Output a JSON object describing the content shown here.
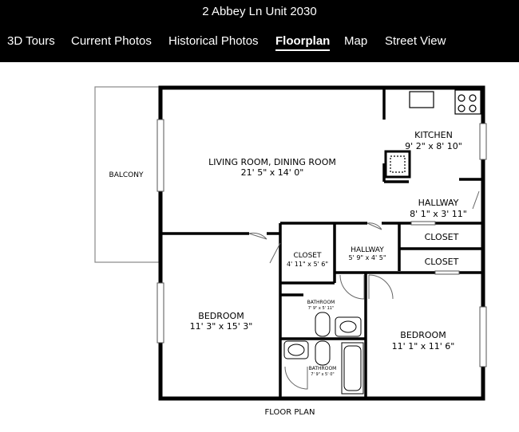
{
  "header": {
    "title": "2 Abbey Ln Unit 2030"
  },
  "tabs": [
    {
      "label": "3D Tours",
      "active": false
    },
    {
      "label": "Current Photos",
      "active": false
    },
    {
      "label": "Historical Photos",
      "active": false
    },
    {
      "label": "Floorplan",
      "active": true
    },
    {
      "label": "Map",
      "active": false
    },
    {
      "label": "Street View",
      "active": false
    }
  ],
  "floorplan": {
    "caption": "FLOOR PLAN",
    "rooms": {
      "balcony": {
        "name": "BALCONY"
      },
      "living": {
        "name": "LIVING ROOM, DINING ROOM",
        "size": "21' 5\" x 14' 0\""
      },
      "kitchen": {
        "name": "KITCHEN",
        "size": "9' 2\" x 8' 10\""
      },
      "hallway_main": {
        "name": "HALLWAY",
        "size": "8' 1\" x 3' 11\""
      },
      "closet_right_1": {
        "name": "CLOSET"
      },
      "closet_right_2": {
        "name": "CLOSET"
      },
      "closet_mid": {
        "name": "CLOSET",
        "size": "4' 11\" x 5' 6\""
      },
      "hallway_small": {
        "name": "HALLWAY",
        "size": "5' 9\" x 4' 5\""
      },
      "bedroom_left": {
        "name": "BEDROOM",
        "size": "11' 3\" x 15' 3\""
      },
      "bathroom_1": {
        "name": "BATHROOM",
        "size": "7' 9\" x 5' 11\""
      },
      "bathroom_2": {
        "name": "BATHROOM",
        "size": "7' 9\" x 5' 0\""
      },
      "bedroom_right": {
        "name": "BEDROOM",
        "size": "11' 1\" x 11' 6\""
      }
    }
  }
}
